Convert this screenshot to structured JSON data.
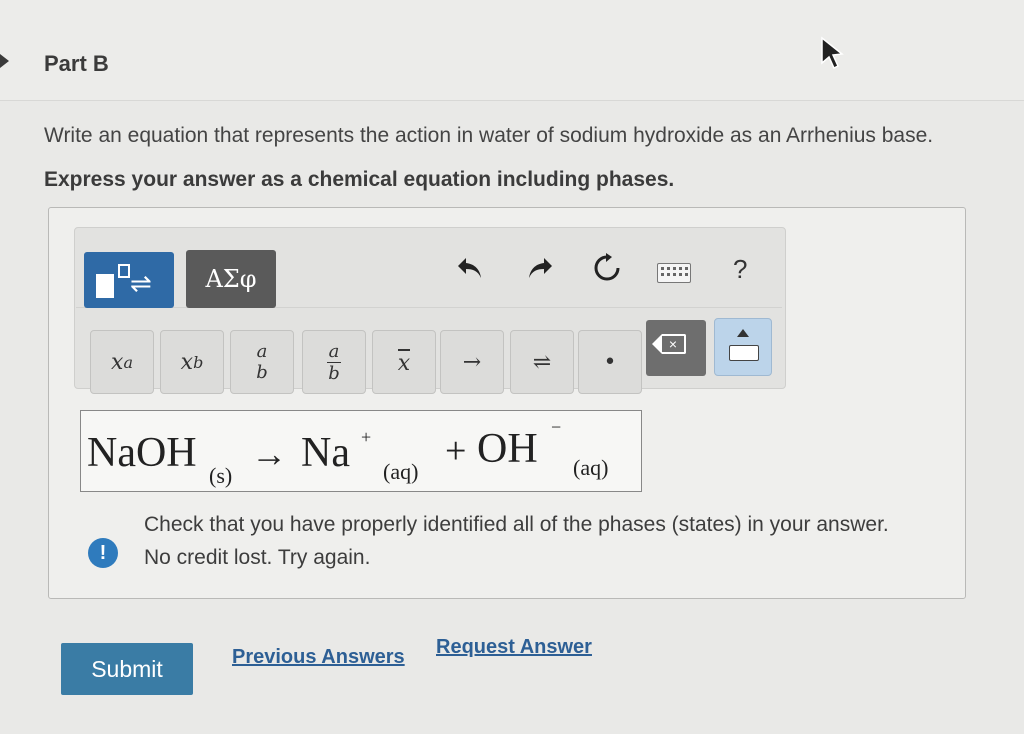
{
  "part": {
    "title": "Part B"
  },
  "question": {
    "prompt": "Write an equation that represents the action in water of sodium hydroxide as an Arrhenius base.",
    "instruction": "Express your answer as a chemical equation including phases."
  },
  "toolbar": {
    "greek_label": "ΑΣφ",
    "help_label": "?",
    "keys": {
      "sup_base": "x",
      "sup_exp": "a",
      "sub_base": "x",
      "sub_exp": "b",
      "frac_num": "a",
      "frac_den": "b",
      "frac2_num": "a",
      "frac2_den": "b",
      "bar": "x",
      "arrow": "→",
      "equilibrium": "⇌",
      "dot": "•"
    }
  },
  "equation": {
    "reactant": "NaOH",
    "reactant_phase": "(s)",
    "arrow": "→",
    "product1": "Na",
    "product1_charge": "+",
    "product1_phase": "(aq)",
    "plus": "+",
    "product2": "OH",
    "product2_charge": "−",
    "product2_phase": "(aq)"
  },
  "feedback": {
    "icon": "!",
    "line1": "Check that you have properly identified all of the phases (states) in your answer.",
    "line2": "No credit lost. Try again."
  },
  "actions": {
    "submit": "Submit",
    "previous_answers": "Previous Answers",
    "request_answer": "Request Answer"
  },
  "colors": {
    "primary": "#2f6aa6",
    "submit": "#3a7ca5",
    "link": "#2d5f95",
    "feedback_icon": "#2f7bbd"
  }
}
